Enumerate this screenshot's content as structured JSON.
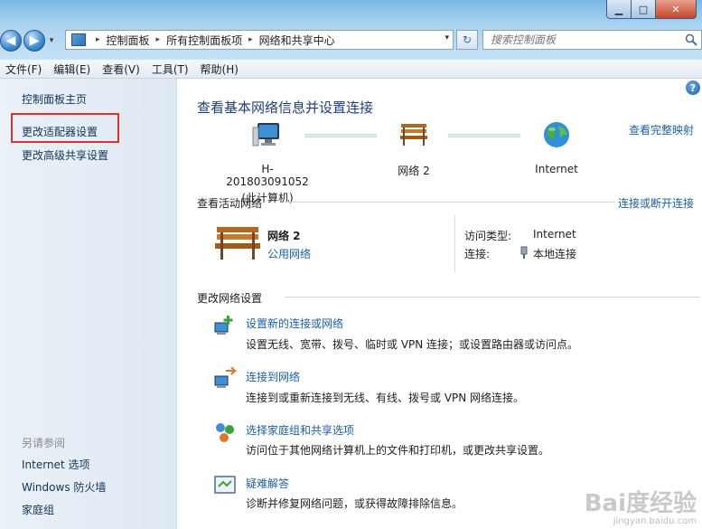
{
  "window": {
    "min_glyph": "▁",
    "max_glyph": "□",
    "close_glyph": "✕"
  },
  "nav": {
    "back_glyph": "◀",
    "forward_glyph": "▶",
    "history_glyph": "▾"
  },
  "address": {
    "separator": "▸",
    "crumbs": [
      "控制面板",
      "所有控制面板项",
      "网络和共享中心"
    ],
    "dropdown_glyph": "▾",
    "refresh_glyph": "↻"
  },
  "search": {
    "placeholder": "搜索控制面板"
  },
  "menu": [
    "文件(F)",
    "编辑(E)",
    "查看(V)",
    "工具(T)",
    "帮助(H)"
  ],
  "left": {
    "home": "控制面板主页",
    "adapter": "更改适配器设置",
    "advanced_sharing": "更改高级共享设置",
    "see_also": "另请参阅",
    "internet_options": "Internet 选项",
    "firewall": "Windows 防火墙",
    "homegroup": "家庭组"
  },
  "main": {
    "help_glyph": "?",
    "title": "查看基本网络信息并设置连接",
    "full_map": "查看完整映射",
    "map": {
      "computer_name": "H-201803091052",
      "computer_sub": "(此计算机)",
      "network": "网络  2",
      "internet": "Internet"
    },
    "active_section": "查看活动网络",
    "connect_disconnect": "连接或断开连接",
    "active": {
      "name": "网络  2",
      "type": "公用网络",
      "access_label": "访问类型:",
      "access_value": "Internet",
      "conn_label": "连接:",
      "conn_value": "本地连接"
    },
    "change_section": "更改网络设置",
    "tasks": [
      {
        "title": "设置新的连接或网络",
        "desc": "设置无线、宽带、拨号、临时或 VPN 连接；或设置路由器或访问点。"
      },
      {
        "title": "连接到网络",
        "desc": "连接到或重新连接到无线、有线、拨号或 VPN 网络连接。"
      },
      {
        "title": "选择家庭组和共享选项",
        "desc": "访问位于其他网络计算机上的文件和打印机，或更改共享设置。"
      },
      {
        "title": "疑难解答",
        "desc": "诊断并修复网络问题，或获得故障排除信息。"
      }
    ]
  },
  "watermark": {
    "logo": "Bai度经验",
    "url": "jingyan.baidu.com"
  }
}
